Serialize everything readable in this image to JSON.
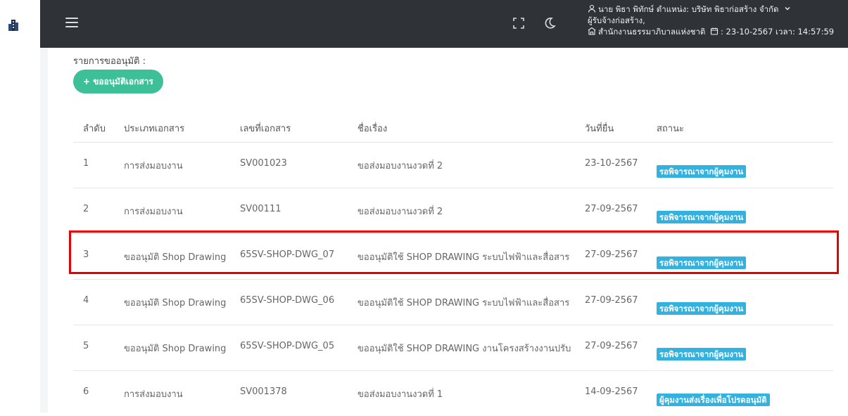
{
  "header": {
    "user_line1": "นาย พิธา พิทักษ์ ตำแหน่ง: บริษัท พิธาก่อสร้าง จำกัด",
    "user_line2": "ผู้รับจ้างก่อสร้าง,",
    "user_line3_org": "สำนักงานธรรมาภิบาลแห่งชาติ",
    "user_line3_date": ": 23-10-2567 เวลา: 14:57:59"
  },
  "content": {
    "list_title": "รายการขออนุมัติ :",
    "add_button": "+ ขออนุมัติเอกสาร"
  },
  "table": {
    "headers": [
      "ลำดับ",
      "ประเภทเอกสาร",
      "เลขที่เอกสาร",
      "ชื่อเรื่อง",
      "วันที่ยื่น",
      "สถานะ"
    ],
    "rows": [
      [
        "1",
        "การส่งมอบงาน",
        "SV001023",
        "ขอส่งมอบงานงวดที่ 2",
        "23-10-2567",
        "รอพิจารณาจากผู้คุมงาน"
      ],
      [
        "2",
        "การส่งมอบงาน",
        "SV00111",
        "ขอส่งมอบงานงวดที่ 2",
        "27-09-2567",
        "รอพิจารณาจากผู้คุมงาน"
      ],
      [
        "3",
        "ขออนุมัติ Shop Drawing",
        "65SV-SHOP-DWG_07",
        "ขออนุมัติใช้ SHOP DRAWING ระบบไฟฟ้าและสื่อสาร",
        "27-09-2567",
        "รอพิจารณาจากผู้คุมงาน"
      ],
      [
        "4",
        "ขออนุมัติ Shop Drawing",
        "65SV-SHOP-DWG_06",
        "ขออนุมัติใช้ SHOP DRAWING ระบบไฟฟ้าและสื่อสาร",
        "27-09-2567",
        "รอพิจารณาจากผู้คุมงาน"
      ],
      [
        "5",
        "ขออนุมัติ Shop Drawing",
        "65SV-SHOP-DWG_05",
        "ขออนุมัติใช้ SHOP DRAWING งานโครงสร้างงานปรับ",
        "27-09-2567",
        "รอพิจารณาจากผู้คุมงาน"
      ],
      [
        "6",
        "การส่งมอบงาน",
        "SV001378",
        "ขอส่งมอบงานงวดที่ 1",
        "14-09-2567",
        "ผู้คุมงานส่งเรื่องเพื่อโปรดอนุมัติ"
      ]
    ]
  },
  "icons": {
    "logo": "building-logo-icon",
    "menu": "hamburger-menu-icon",
    "fullscreen": "fullscreen-icon",
    "theme": "moon-icon",
    "user": "user-icon",
    "chevron": "chevron-down-icon",
    "org": "building-icon",
    "date": "calendar-icon"
  },
  "colors": {
    "topbar": "#2f3337",
    "add_button": "#3dbf97",
    "status_badge": "#33b2e0",
    "highlight": "#e60000"
  }
}
